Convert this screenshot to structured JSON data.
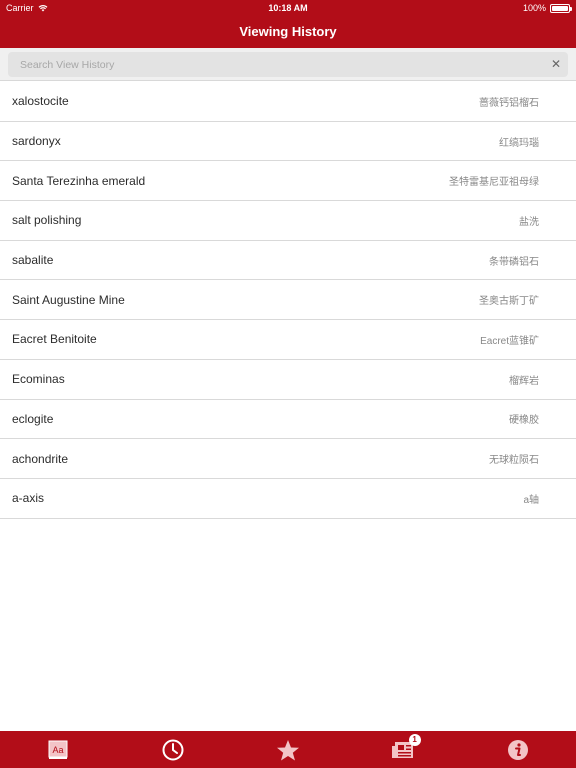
{
  "status_bar": {
    "carrier": "Carrier",
    "time": "10:18 AM",
    "battery": "100%",
    "battery_level": 1.0
  },
  "header": {
    "title": "Viewing History"
  },
  "search": {
    "placeholder": "Search View History",
    "value": ""
  },
  "history": [
    {
      "term": "xalostocite",
      "translation": "蔷薇钙铝榴石"
    },
    {
      "term": "sardonyx",
      "translation": "红缟玛瑙"
    },
    {
      "term": "Santa Terezinha emerald",
      "translation": "圣特雷基尼亚祖母绿"
    },
    {
      "term": "salt polishing",
      "translation": "盐洗"
    },
    {
      "term": "sabalite",
      "translation": "条带磷铝石"
    },
    {
      "term": "Saint Augustine Mine",
      "translation": "圣奥古斯丁矿"
    },
    {
      "term": "Eacret Benitoite",
      "translation": "Eacret蓝锥矿"
    },
    {
      "term": "Ecominas",
      "translation": "榴辉岩"
    },
    {
      "term": "eclogite",
      "translation": "硬橡胶"
    },
    {
      "term": "achondrite",
      "translation": "无球粒陨石"
    },
    {
      "term": "a-axis",
      "translation": "a轴"
    }
  ],
  "tabbar": {
    "dictionary_label": "Aa",
    "news_badge": "1",
    "icons": [
      "dictionary-icon",
      "clock-icon",
      "star-icon",
      "news-icon",
      "info-icon"
    ]
  },
  "colors": {
    "brand": "#b20d18",
    "search_bg": "#f0f0f0"
  }
}
